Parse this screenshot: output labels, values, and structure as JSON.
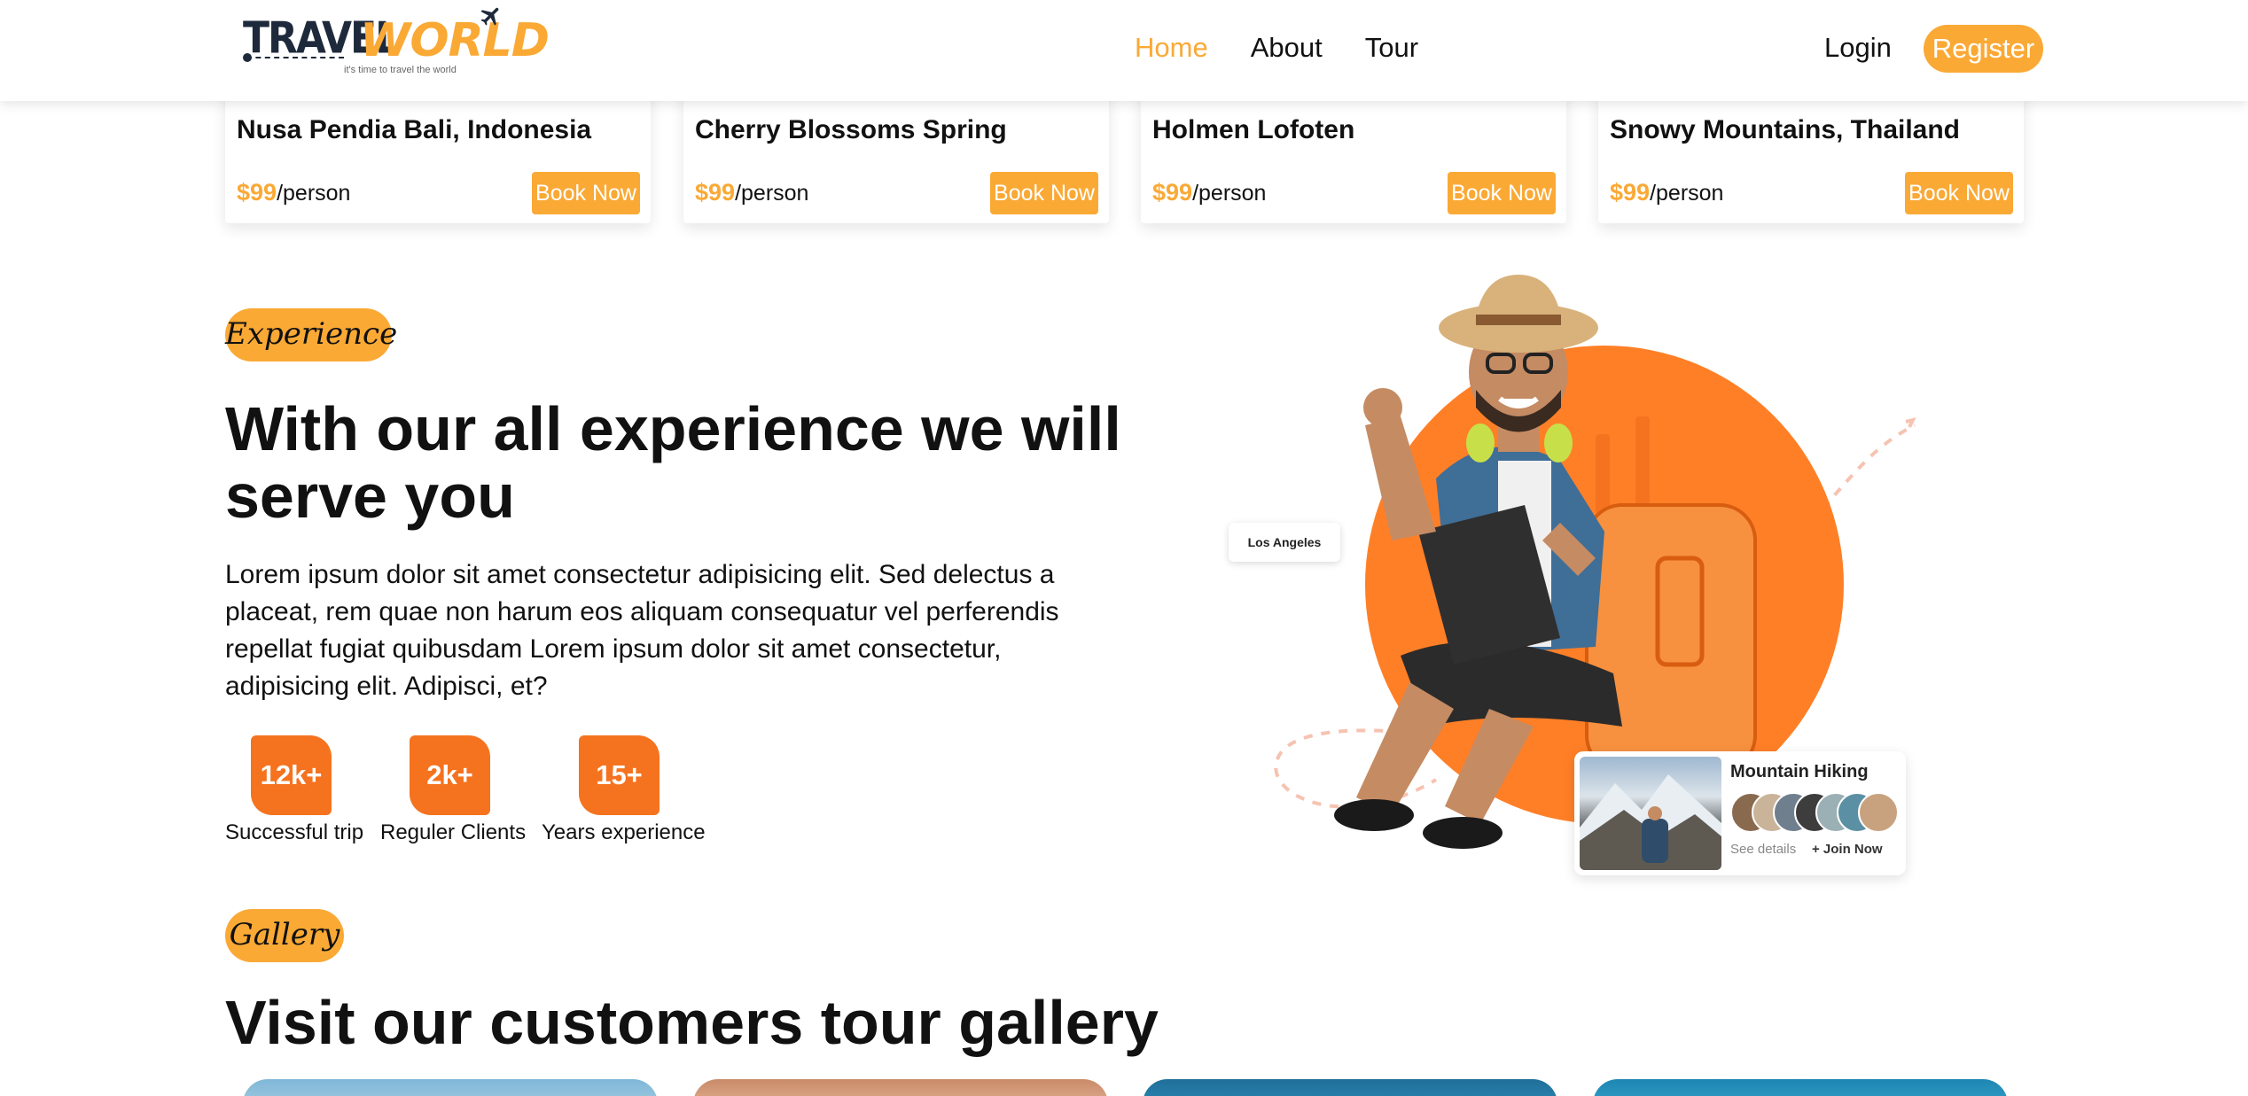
{
  "brand": {
    "logo_part1": "TRAVEL",
    "logo_part2": "WORLD",
    "tagline": "it's time to travel the world",
    "accent_color": "#faa935",
    "stat_color": "#f5731f"
  },
  "nav": {
    "links": [
      "Home",
      "About",
      "Tour"
    ],
    "login_label": "Login",
    "register_label": "Register"
  },
  "tours": [
    {
      "title": "Nusa Pendia Bali, Indonesia",
      "price": "$99",
      "unit": "/person",
      "button": "Book Now"
    },
    {
      "title": "Cherry Blossoms Spring",
      "price": "$99",
      "unit": "/person",
      "button": "Book Now"
    },
    {
      "title": "Holmen Lofoten",
      "price": "$99",
      "unit": "/person",
      "button": "Book Now"
    },
    {
      "title": "Snowy Mountains, Thailand",
      "price": "$99",
      "unit": "/person",
      "button": "Book Now"
    }
  ],
  "experience": {
    "pill": "Experience",
    "heading": "With our all experience we will serve you",
    "body": "Lorem ipsum dolor sit amet consectetur adipisicing elit. Sed delectus a placeat, rem quae non harum eos aliquam consequatur vel perferendis repellat fugiat quibusdam Lorem ipsum dolor sit amet consectetur, adipisicing elit. Adipisci, et?",
    "stats": [
      {
        "value": "12k+",
        "label": "Successful trip"
      },
      {
        "value": "2k+",
        "label": "Reguler Clients"
      },
      {
        "value": "15+",
        "label": "Years experience"
      }
    ]
  },
  "hero": {
    "location_tag": "Los Angeles",
    "card_title": "Mountain Hiking",
    "see_details": "See details",
    "join_now": "+ Join Now"
  },
  "gallery": {
    "pill": "Gallery",
    "heading": "Visit our customers tour gallery"
  }
}
